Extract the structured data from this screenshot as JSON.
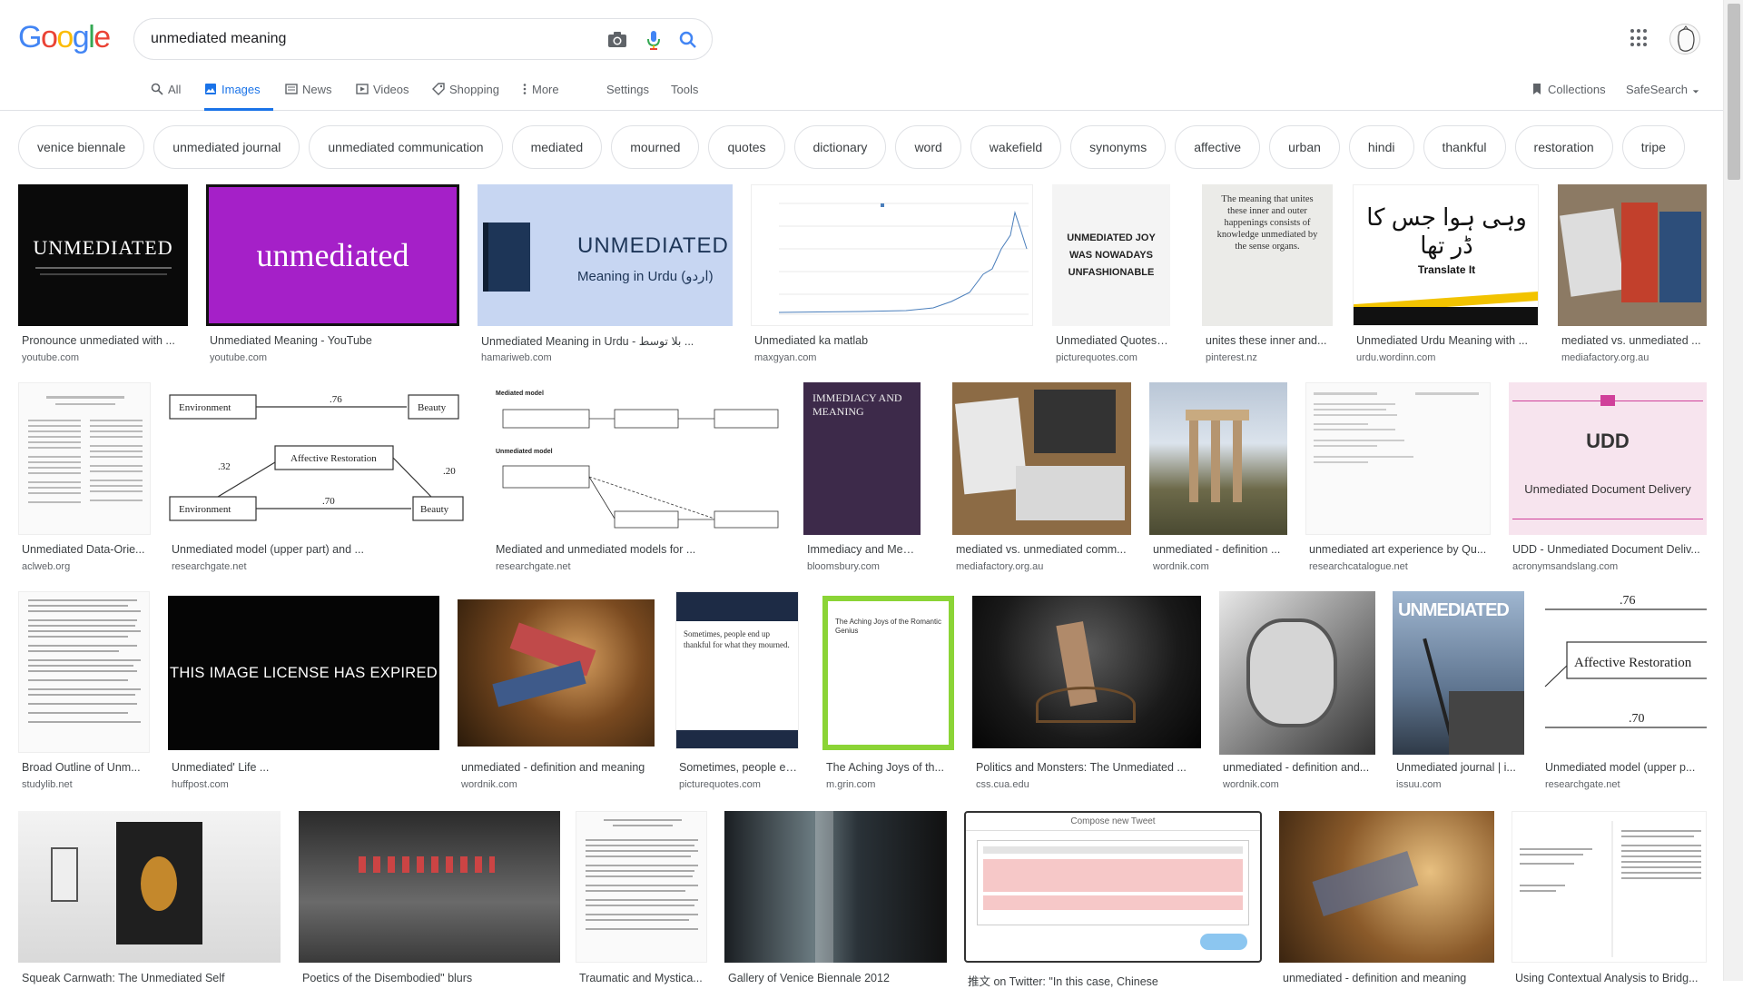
{
  "search": {
    "query": "unmediated meaning"
  },
  "logo": [
    "G",
    "o",
    "o",
    "g",
    "l",
    "e"
  ],
  "tabs": {
    "all": "All",
    "images": "Images",
    "news": "News",
    "videos": "Videos",
    "shopping": "Shopping",
    "more": "More",
    "settings": "Settings",
    "tools": "Tools",
    "collections": "Collections",
    "safesearch": "SafeSearch"
  },
  "chips": [
    "venice biennale",
    "unmediated journal",
    "unmediated communication",
    "mediated",
    "mourned",
    "quotes",
    "dictionary",
    "word",
    "wakefield",
    "synonyms",
    "affective",
    "urban",
    "hindi",
    "thankful",
    "restoration",
    "tripe"
  ],
  "results": {
    "r1": [
      {
        "caption": "Pronounce unmediated with ...",
        "source": "youtube.com",
        "thumb_text": "UNMEDIATED"
      },
      {
        "caption": "Unmediated Meaning - YouTube",
        "source": "youtube.com",
        "thumb_text": "unmediated"
      },
      {
        "caption": "Unmediated Meaning in Urdu - بلا توسط ...",
        "source": "hamariweb.com",
        "thumb_text": "UNMEDIATED",
        "thumb_sub": "Meaning in Urdu (اردو)"
      },
      {
        "caption": "Unmediated ka matlab",
        "source": "maxgyan.com"
      },
      {
        "caption": "Unmediated Quotes | ...",
        "source": "picturequotes.com",
        "thumb_text": "UNMEDIATED JOY WAS NOWADAYS UNFASHIONABLE"
      },
      {
        "caption": "unites these inner and...",
        "source": "pinterest.nz",
        "thumb_text": "The meaning that unites these inner and outer happenings consists of knowledge unmediated by the sense organs."
      },
      {
        "caption": "Unmediated Urdu Meaning with ...",
        "source": "urdu.wordinn.com",
        "thumb_text": "وہی ہوا جس کا ڈر تھا",
        "thumb_sub": "Translate It"
      },
      {
        "caption": "mediated vs. unmediated ...",
        "source": "mediafactory.org.au"
      }
    ],
    "r2": [
      {
        "caption": "Unmediated Data-Orie...",
        "source": "aclweb.org"
      },
      {
        "caption": "Unmediated model (upper part) and ...",
        "source": "researchgate.net",
        "thumb_text": "Affective Restoration"
      },
      {
        "caption": "Mediated and unmediated models for ...",
        "source": "researchgate.net",
        "thumb_text": "Mediated model",
        "thumb_sub": "Unmediated model"
      },
      {
        "caption": "Immediacy and Meani...",
        "source": "bloomsbury.com",
        "thumb_text": "IMMEDIACY AND MEANING"
      },
      {
        "caption": "mediated vs. unmediated comm...",
        "source": "mediafactory.org.au"
      },
      {
        "caption": "unmediated - definition ...",
        "source": "wordnik.com"
      },
      {
        "caption": "unmediated art experience by Qu...",
        "source": "researchcatalogue.net"
      },
      {
        "caption": "UDD - Unmediated Document Deliv...",
        "source": "acronymsandslang.com",
        "thumb_text": "UDD",
        "thumb_sub": "Unmediated Document Delivery"
      }
    ],
    "r3": [
      {
        "caption": "Broad Outline of Unm...",
        "source": "studylib.net"
      },
      {
        "caption": "Unmediated' Life ...",
        "source": "huffpost.com",
        "thumb_text": "THIS IMAGE LICENSE HAS EXPIRED"
      },
      {
        "caption": "unmediated - definition and meaning",
        "source": "wordnik.com"
      },
      {
        "caption": "Sometimes, people en...",
        "source": "picturequotes.com",
        "thumb_text": "Sometimes, people end up thankful for what they mourned."
      },
      {
        "caption": "The Aching Joys of th...",
        "source": "m.grin.com",
        "thumb_text": "The Aching Joys of the Romantic Genius"
      },
      {
        "caption": "Politics and Monsters: The Unmediated ...",
        "source": "css.cua.edu"
      },
      {
        "caption": "unmediated - definition and...",
        "source": "wordnik.com"
      },
      {
        "caption": "Unmediated journal | i...",
        "source": "issuu.com",
        "thumb_text": "UNMEDIATED"
      },
      {
        "caption": "Unmediated model (upper p...",
        "source": "researchgate.net",
        "thumb_text": "Affective Restoration"
      }
    ],
    "r4": [
      {
        "caption": "Squeak Carnwath: The Unmediated Self",
        "source": ""
      },
      {
        "caption": "Poetics of the Disembodied\" blurs",
        "source": ""
      },
      {
        "caption": "Traumatic and Mystica...",
        "source": ""
      },
      {
        "caption": "Gallery of Venice Biennale 2012",
        "source": ""
      },
      {
        "caption": "推文 on Twitter: \"In this case, Chinese",
        "source": "",
        "thumb_text": "Compose new Tweet"
      },
      {
        "caption": "unmediated - definition and meaning",
        "source": ""
      },
      {
        "caption": "Using Contextual Analysis to Bridg...",
        "source": ""
      }
    ]
  },
  "colors": {
    "accent": "#1a73e8",
    "link": "#3c4043",
    "source": "#5f6368"
  }
}
